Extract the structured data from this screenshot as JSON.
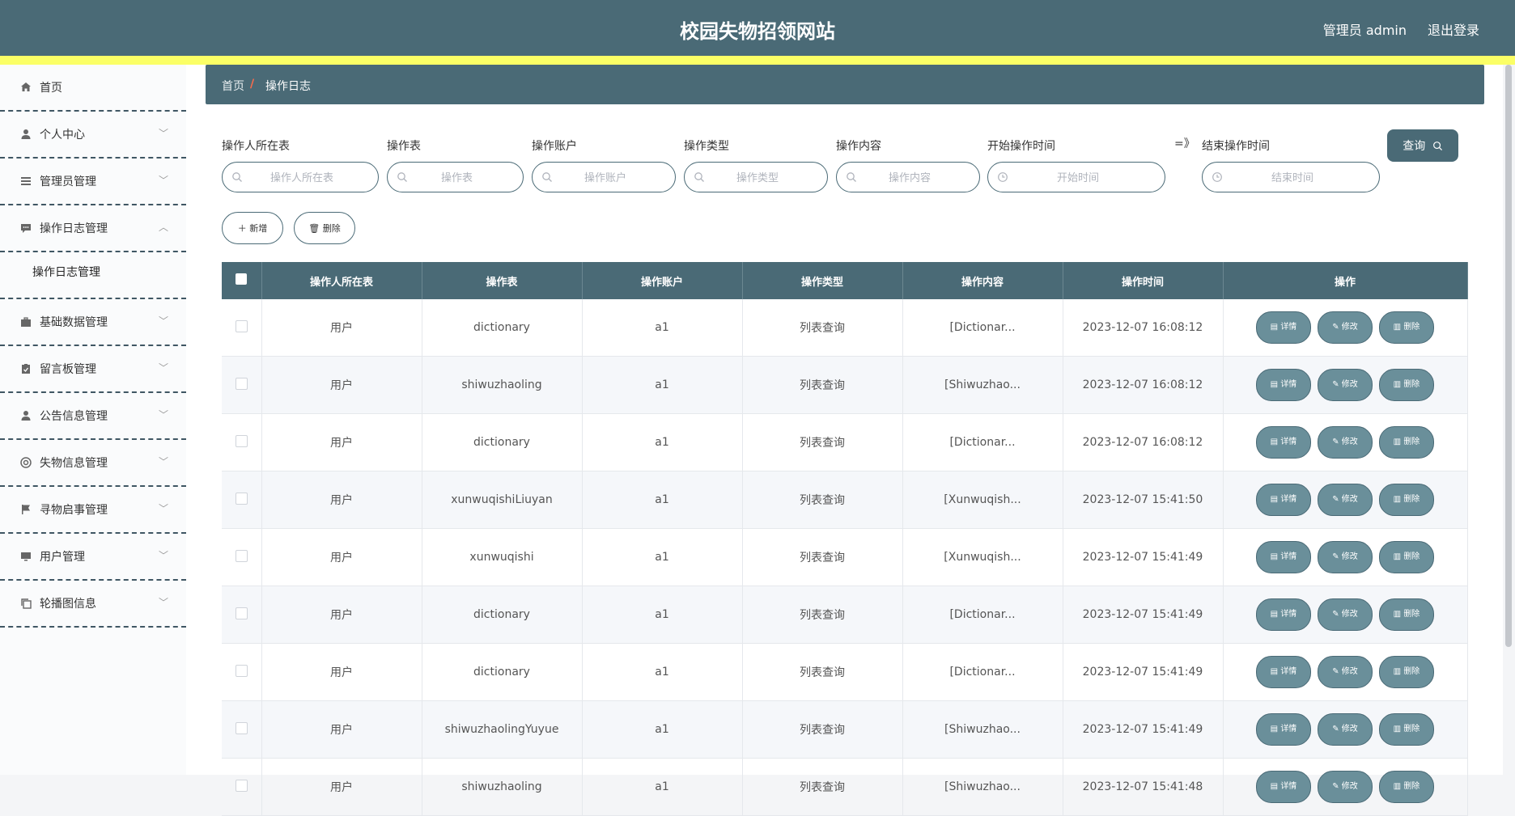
{
  "header": {
    "title": "校园失物招领网站",
    "user": "管理员 admin",
    "logout": "退出登录"
  },
  "sidebar": {
    "items": [
      {
        "label": "首页",
        "icon": "home-icon",
        "has_children": false
      },
      {
        "label": "个人中心",
        "icon": "user-icon",
        "has_children": true
      },
      {
        "label": "管理员管理",
        "icon": "list-icon",
        "has_children": true
      },
      {
        "label": "操作日志管理",
        "icon": "chat-icon",
        "has_children": true,
        "expanded": true
      },
      {
        "label": "基础数据管理",
        "icon": "briefcase-icon",
        "has_children": true
      },
      {
        "label": "留言板管理",
        "icon": "clipboard-icon",
        "has_children": true
      },
      {
        "label": "公告信息管理",
        "icon": "user-icon",
        "has_children": true
      },
      {
        "label": "失物信息管理",
        "icon": "lifebuoy-icon",
        "has_children": true
      },
      {
        "label": "寻物启事管理",
        "icon": "flag-icon",
        "has_children": true
      },
      {
        "label": "用户管理",
        "icon": "monitor-icon",
        "has_children": true
      },
      {
        "label": "轮播图信息",
        "icon": "copy-icon",
        "has_children": true
      }
    ],
    "submenu": {
      "label": "操作日志管理"
    }
  },
  "breadcrumb": {
    "home": "首页",
    "sep": "/",
    "current": "操作日志"
  },
  "filters": {
    "f1": {
      "label": "操作人所在表",
      "placeholder": "操作人所在表"
    },
    "f2": {
      "label": "操作表",
      "placeholder": "操作表"
    },
    "f3": {
      "label": "操作账户",
      "placeholder": "操作账户"
    },
    "f4": {
      "label": "操作类型",
      "placeholder": "操作类型"
    },
    "f5": {
      "label": "操作内容",
      "placeholder": "操作内容"
    },
    "f6": {
      "label": "开始操作时间",
      "placeholder": "开始时间"
    },
    "arrow": "=》",
    "f7": {
      "label": "结束操作时间",
      "placeholder": "结束时间"
    },
    "query": "查询"
  },
  "actions": {
    "add": "新增",
    "delete": "删除"
  },
  "table": {
    "headers": [
      "操作人所在表",
      "操作表",
      "操作账户",
      "操作类型",
      "操作内容",
      "操作时间",
      "操作"
    ],
    "row_actions": {
      "detail": "详情",
      "edit": "修改",
      "delete": "删除"
    },
    "rows": [
      [
        "用户",
        "dictionary",
        "a1",
        "列表查询",
        "[Dictionar...",
        "2023-12-07 16:08:12"
      ],
      [
        "用户",
        "shiwuzhaoling",
        "a1",
        "列表查询",
        "[Shiwuzhao...",
        "2023-12-07 16:08:12"
      ],
      [
        "用户",
        "dictionary",
        "a1",
        "列表查询",
        "[Dictionar...",
        "2023-12-07 16:08:12"
      ],
      [
        "用户",
        "xunwuqishiLiuyan",
        "a1",
        "列表查询",
        "[Xunwuqish...",
        "2023-12-07 15:41:50"
      ],
      [
        "用户",
        "xunwuqishi",
        "a1",
        "列表查询",
        "[Xunwuqish...",
        "2023-12-07 15:41:49"
      ],
      [
        "用户",
        "dictionary",
        "a1",
        "列表查询",
        "[Dictionar...",
        "2023-12-07 15:41:49"
      ],
      [
        "用户",
        "dictionary",
        "a1",
        "列表查询",
        "[Dictionar...",
        "2023-12-07 15:41:49"
      ],
      [
        "用户",
        "shiwuzhaolingYuyue",
        "a1",
        "列表查询",
        "[Shiwuzhao...",
        "2023-12-07 15:41:49"
      ],
      [
        "用户",
        "shiwuzhaoling",
        "a1",
        "列表查询",
        "[Shiwuzhao...",
        "2023-12-07 15:41:48"
      ]
    ]
  },
  "colors": {
    "primary": "#4a6a76",
    "accent_bar": "#fbff66",
    "action_button": "#6a8f9a"
  }
}
